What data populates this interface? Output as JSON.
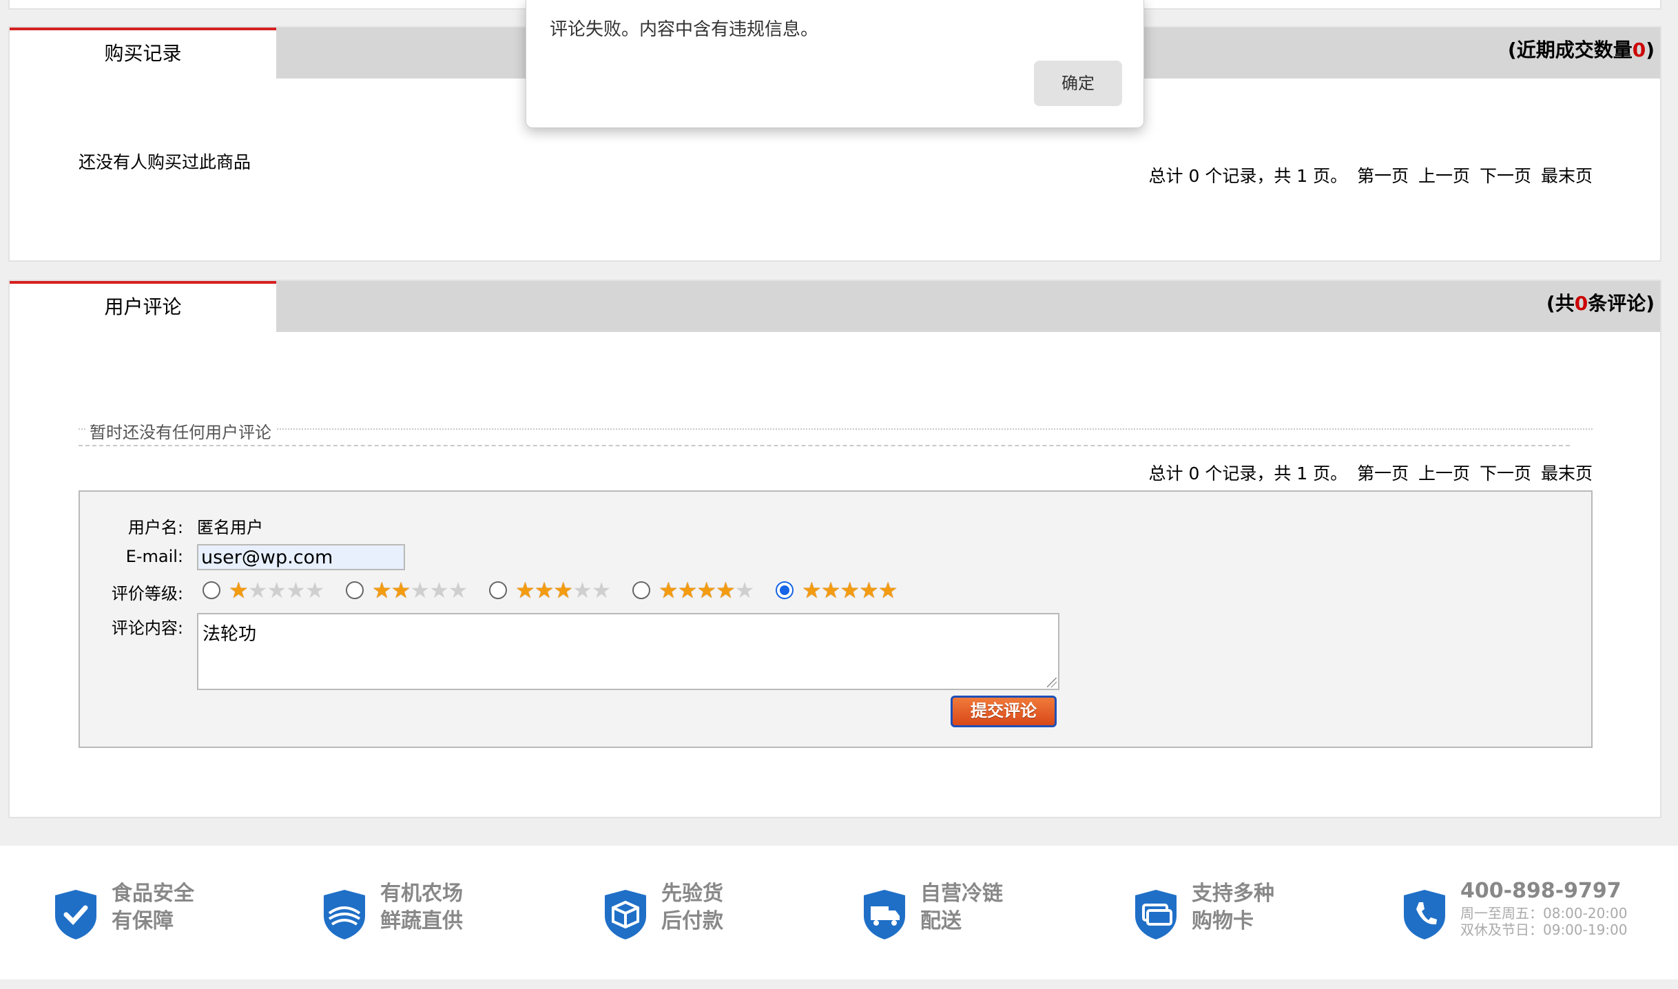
{
  "purchase_panel": {
    "tab_label": "购买记录",
    "summary_prefix": "(近期成交数量",
    "summary_count": "0",
    "summary_suffix": ")",
    "empty_text": "还没有人购买过此商品"
  },
  "pager": {
    "summary": "总计 0 个记录，共 1 页。",
    "first": "第一页",
    "prev": "上一页",
    "next": "下一页",
    "last": "最末页"
  },
  "review_panel": {
    "tab_label": "用户评论",
    "summary_prefix": "(共",
    "summary_count": "0",
    "summary_suffix": "条评论)",
    "empty_text": "暂时还没有任何用户评论"
  },
  "form": {
    "username_label": "用户名:",
    "username_value": "匿名用户",
    "email_label": "E-mail:",
    "email_value": "user@wp.com",
    "rating_label": "评价等级:",
    "ratings": [
      1,
      2,
      3,
      4,
      5
    ],
    "selected_rating": 5,
    "content_label": "评论内容:",
    "content_value": "法轮功",
    "submit_label": "提交评论"
  },
  "footer": {
    "items": [
      {
        "icon": "check-shield-icon",
        "line1": "食品安全",
        "line2": "有保障"
      },
      {
        "icon": "farm-shield-icon",
        "line1": "有机农场",
        "line2": "鲜蔬直供"
      },
      {
        "icon": "box-shield-icon",
        "line1": "先验货",
        "line2": "后付款"
      },
      {
        "icon": "truck-shield-icon",
        "line1": "自营冷链",
        "line2": "配送"
      },
      {
        "icon": "card-shield-icon",
        "line1": "支持多种",
        "line2": "购物卡"
      }
    ],
    "phone": "400-898-9797",
    "hours_weekday": "周一至周五：08:00-20:00",
    "hours_weekend": "双休及节日：09:00-19:00"
  },
  "dialog": {
    "message": "评论失败。内容中含有违规信息。",
    "ok_label": "确定"
  },
  "colors": {
    "accent_red": "#d52020",
    "shield_blue": "#1f6fc7",
    "submit_orange": "#e0561f",
    "radio_blue": "#1565e6"
  }
}
